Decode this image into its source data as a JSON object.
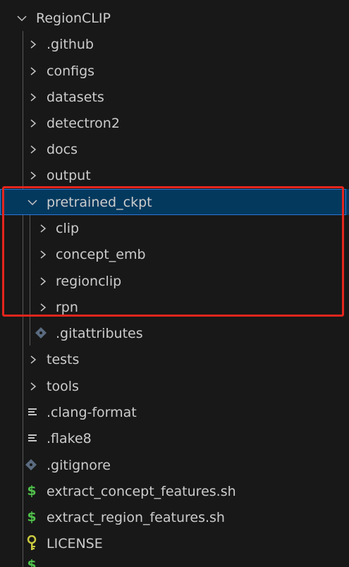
{
  "explorer": {
    "root_label": "RegionCLIP",
    "items": [
      {
        "label": ".github",
        "kind": "folder"
      },
      {
        "label": "configs",
        "kind": "folder"
      },
      {
        "label": "datasets",
        "kind": "folder"
      },
      {
        "label": "detectron2",
        "kind": "folder"
      },
      {
        "label": "docs",
        "kind": "folder"
      },
      {
        "label": "output",
        "kind": "folder"
      },
      {
        "label": "pretrained_ckpt",
        "kind": "folder-open",
        "selected": true
      },
      {
        "label": "clip",
        "kind": "folder"
      },
      {
        "label": "concept_emb",
        "kind": "folder"
      },
      {
        "label": "regionclip",
        "kind": "folder"
      },
      {
        "label": "rpn",
        "kind": "folder"
      },
      {
        "label": ".gitattributes",
        "kind": "git-file"
      },
      {
        "label": "tests",
        "kind": "folder"
      },
      {
        "label": "tools",
        "kind": "folder"
      },
      {
        "label": ".clang-format",
        "kind": "text-file"
      },
      {
        "label": ".flake8",
        "kind": "text-file"
      },
      {
        "label": ".gitignore",
        "kind": "git-file"
      },
      {
        "label": "extract_concept_features.sh",
        "kind": "shell-file"
      },
      {
        "label": "extract_region_features.sh",
        "kind": "shell-file"
      },
      {
        "label": "LICENSE",
        "kind": "license-file"
      }
    ]
  },
  "icons": {
    "chevron_right": "chevron-right-icon",
    "chevron_down": "chevron-down-icon",
    "git": "git-file-icon",
    "text": "text-file-icon",
    "shell": "shell-file-icon",
    "license": "license-key-icon"
  },
  "colors": {
    "background": "#181818",
    "selected_row": "#04395e",
    "selected_border": "#2b79d8",
    "highlight_box": "#e5251d",
    "shell_icon": "#4fc04a",
    "license_icon": "#cbcb41",
    "git_icon": "#5a6b80"
  },
  "annotation": {
    "highlight": "red box around pretrained_ckpt folder"
  }
}
